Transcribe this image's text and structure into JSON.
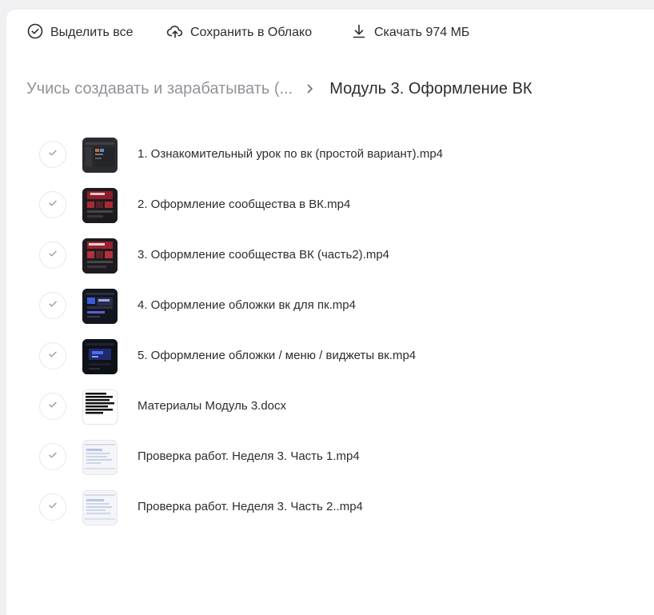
{
  "toolbar": {
    "select_all": {
      "label": "Выделить все",
      "icon": "check-circle-icon"
    },
    "save_to_cloud": {
      "label": "Сохранить в Облако",
      "icon": "cloud-upload-icon"
    },
    "download": {
      "label": "Скачать 974 МБ",
      "icon": "download-icon"
    }
  },
  "breadcrumb": {
    "parent": "Учись создавать и зарабатывать (...",
    "separator_icon": "chevron-right-icon",
    "current": "Модуль 3. Оформление ВК"
  },
  "files": [
    {
      "name": "1. Ознакомительный урок по вк (простой вариант).mp4",
      "thumb": "video-dark"
    },
    {
      "name": "2. Оформление сообщества в ВК.mp4",
      "thumb": "video-red"
    },
    {
      "name": "3. Оформление сообщества ВК (часть2).mp4",
      "thumb": "video-red"
    },
    {
      "name": "4. Оформление обложки вк для пк.mp4",
      "thumb": "video-blue"
    },
    {
      "name": "5. Оформление обложки / меню / виджеты вк.mp4",
      "thumb": "video-blue2"
    },
    {
      "name": "Материалы Модуль 3.docx",
      "thumb": "document"
    },
    {
      "name": "Проверка работ. Неделя 3. Часть 1.mp4",
      "thumb": "video-light"
    },
    {
      "name": "Проверка работ. Неделя 3. Часть 2..mp4",
      "thumb": "video-light"
    }
  ],
  "colors": {
    "text_primary": "#2c2d2e",
    "text_secondary": "#919399",
    "background": "#f0f0f3",
    "panel": "#ffffff"
  }
}
